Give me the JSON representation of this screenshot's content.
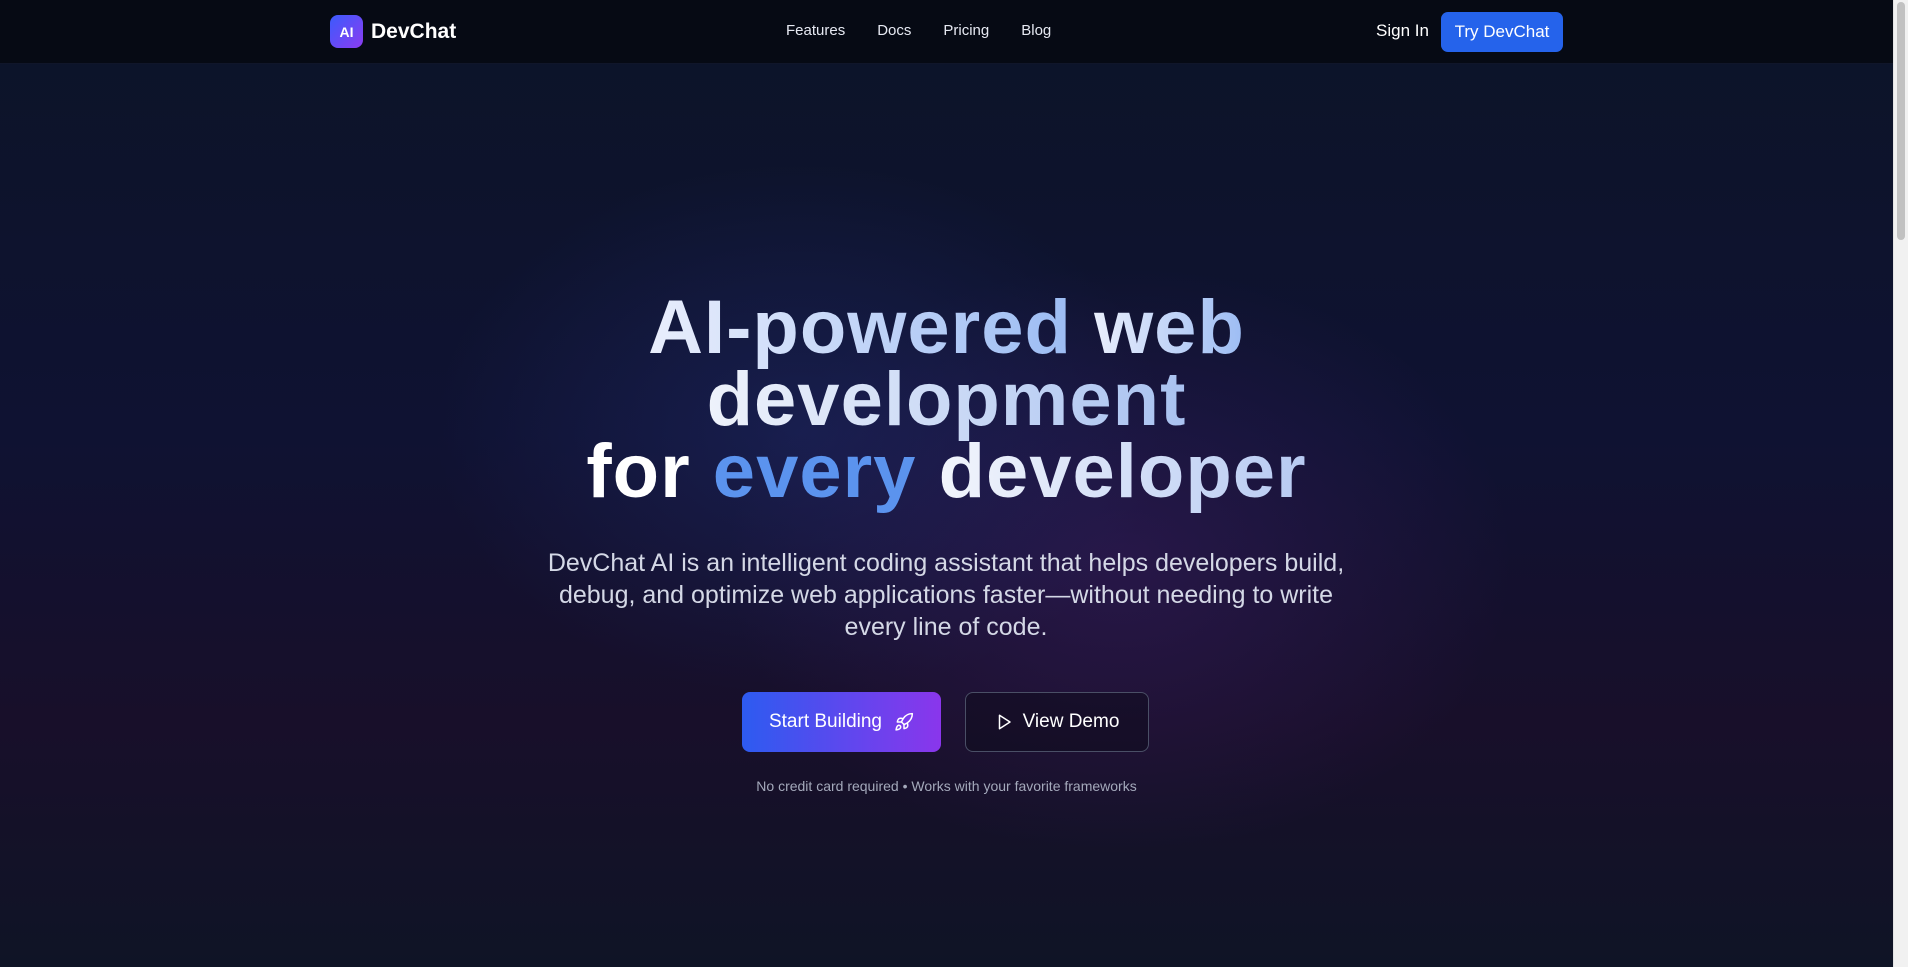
{
  "brand": {
    "logo_text": "AI",
    "name": "DevChat"
  },
  "nav": {
    "links": [
      "Features",
      "Docs",
      "Pricing",
      "Blog"
    ],
    "sign_in": "Sign In",
    "cta": "Try DevChat"
  },
  "hero": {
    "title": {
      "line1_a": "AI-powered",
      "line1_b": "web",
      "line2": "development",
      "line3_a": "for",
      "line3_b": "every",
      "line3_c": "developer"
    },
    "subtitle": "DevChat AI is an intelligent coding assistant that helps developers build, debug, and optimize web applications faster—without needing to write every line of code.",
    "primary_button": "Start Building",
    "primary_icon": "rocket-icon",
    "secondary_button": "View Demo",
    "secondary_icon": "play-icon",
    "footnote": "No credit card required • Works with your favorite frameworks"
  },
  "colors": {
    "accent": "#2563eb",
    "gradient_start": "#2d5bf0",
    "gradient_end": "#8a36ec",
    "highlight_blue": "#5b93ee",
    "nav_background": "#060a14"
  }
}
